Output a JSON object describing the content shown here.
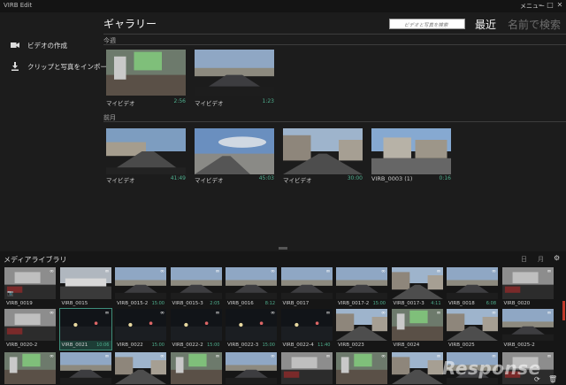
{
  "app": {
    "title": "VIRB Edit",
    "menu_label": "メニュー",
    "min": "–",
    "max": "□",
    "close": "✕"
  },
  "sidebar": {
    "items": [
      {
        "label": "ビデオの作成",
        "icon": "video-camera-icon"
      },
      {
        "label": "クリップと写真をインポート",
        "icon": "import-icon"
      }
    ]
  },
  "header": {
    "title": "ギャラリー",
    "search_placeholder": "ビデオと写真を検索",
    "sort_recent": "最近",
    "sort_name": "名前で検索"
  },
  "gallery": {
    "sections": [
      {
        "label": "今週",
        "items": [
          {
            "title": "マイビデオ",
            "duration": "2:56",
            "scene": "room"
          },
          {
            "title": "マイビデオ",
            "duration": "1:23",
            "scene": "road"
          }
        ]
      },
      {
        "label": "前月",
        "items": [
          {
            "title": "マイビデオ",
            "duration": "41:49",
            "scene": "road2"
          },
          {
            "title": "マイビデオ",
            "duration": "45:03",
            "scene": "sky"
          },
          {
            "title": "マイビデオ",
            "duration": "30:00",
            "scene": "street"
          },
          {
            "title": "VIRB_0003 (1)",
            "duration": "0:16",
            "scene": "houses"
          }
        ]
      }
    ]
  },
  "library": {
    "title": "メディアライブラリ",
    "tab_day": "日",
    "tab_month": "月",
    "rows": [
      [
        {
          "name": "VIRB_0019",
          "duration": "",
          "scene": "car",
          "photo": true
        },
        {
          "name": "VIRB_0015",
          "duration": "",
          "scene": "parking"
        },
        {
          "name": "VIRB_0015-2",
          "duration": "15:00",
          "scene": "road"
        },
        {
          "name": "VIRB_0015-3",
          "duration": "2:05",
          "scene": "road"
        },
        {
          "name": "VIRB_0016",
          "duration": "8:12",
          "scene": "road"
        },
        {
          "name": "VIRB_0017",
          "duration": "",
          "scene": "road"
        },
        {
          "name": "VIRB_0017-2",
          "duration": "15:00",
          "scene": "road"
        },
        {
          "name": "VIRB_0017-3",
          "duration": "4:11",
          "scene": "street"
        },
        {
          "name": "VIRB_0018",
          "duration": "6:08",
          "scene": "road"
        },
        {
          "name": "VIRB_0020",
          "duration": "",
          "scene": "car"
        }
      ],
      [
        {
          "name": "VIRB_0020-2",
          "duration": "",
          "scene": "car"
        },
        {
          "name": "VIRB_0021",
          "duration": "10:06",
          "scene": "night",
          "selected": true
        },
        {
          "name": "VIRB_0022",
          "duration": "15:00",
          "scene": "night"
        },
        {
          "name": "VIRB_0022-2",
          "duration": "15:00",
          "scene": "night"
        },
        {
          "name": "VIRB_0022-3",
          "duration": "15:00",
          "scene": "night"
        },
        {
          "name": "VIRB_0022-4",
          "duration": "11:40",
          "scene": "night"
        },
        {
          "name": "VIRB_0023",
          "duration": "",
          "scene": "street"
        },
        {
          "name": "VIRB_0024",
          "duration": "",
          "scene": "room"
        },
        {
          "name": "VIRB_0025",
          "duration": "",
          "scene": "street"
        },
        {
          "name": "VIRB_0025-2",
          "duration": "",
          "scene": "road"
        }
      ],
      [
        {
          "name": "",
          "duration": "",
          "scene": "room"
        },
        {
          "name": "",
          "duration": "",
          "scene": "road"
        },
        {
          "name": "",
          "duration": "",
          "scene": "street"
        },
        {
          "name": "",
          "duration": "",
          "scene": "room"
        },
        {
          "name": "",
          "duration": "",
          "scene": "road"
        },
        {
          "name": "",
          "duration": "",
          "scene": "car"
        },
        {
          "name": "",
          "duration": "",
          "scene": "room"
        },
        {
          "name": "",
          "duration": "",
          "scene": "street"
        },
        {
          "name": "",
          "duration": "",
          "scene": "road"
        },
        {
          "name": "",
          "duration": "",
          "scene": "car"
        }
      ]
    ]
  },
  "watermark": "Response",
  "colors": {
    "accent": "#4fb08f",
    "background": "#1c1c1c",
    "selection": "#3e8e7a",
    "scroll": "#c0392b"
  }
}
